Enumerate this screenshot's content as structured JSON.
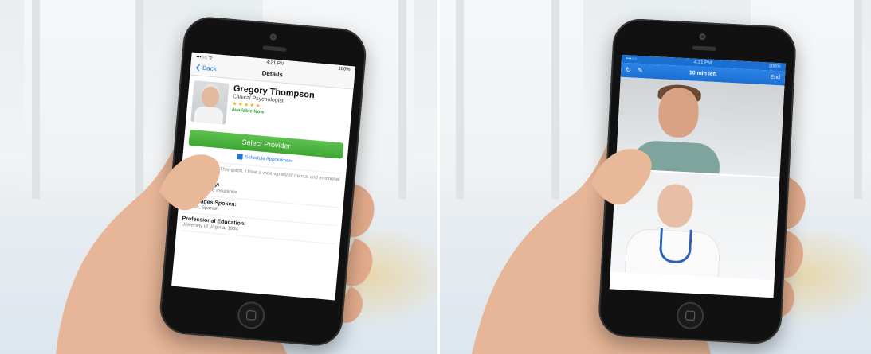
{
  "left_phone": {
    "status_bar": {
      "carrier": "•••○○ ᯤ",
      "time": "4:21 PM",
      "battery": "100%"
    },
    "nav": {
      "back_label": "Back",
      "title": "Details"
    },
    "provider": {
      "name": "Gregory Thompson",
      "title": "Clinical Psychologist",
      "rating": "★★★★★",
      "availability": "Available Now"
    },
    "select_button_label": "Select Provider",
    "schedule_label": "Schedule Appointment",
    "bio": "Hi, I'm Gregory Thompson. I treat a wide variety of mental and emotional health...",
    "sections": [
      {
        "heading": "Visit Co-Pay:",
        "value": "$49.00 Before Insurance"
      },
      {
        "heading": "Languages Spoken:",
        "value": "English, Spanish"
      },
      {
        "heading": "Professional Education:",
        "value": "University of Virginia, 1984"
      }
    ]
  },
  "right_phone": {
    "status_bar": {
      "carrier": "•••○○",
      "time": "4:21 PM",
      "battery": "100%"
    },
    "nav": {
      "title": "10 min left",
      "end_label": "End"
    }
  },
  "colors": {
    "ios_blue": "#1f7ae0",
    "select_green": "#45ab38",
    "video_bar_blue": "#1c6fd2",
    "star_yellow": "#f1b61a"
  }
}
